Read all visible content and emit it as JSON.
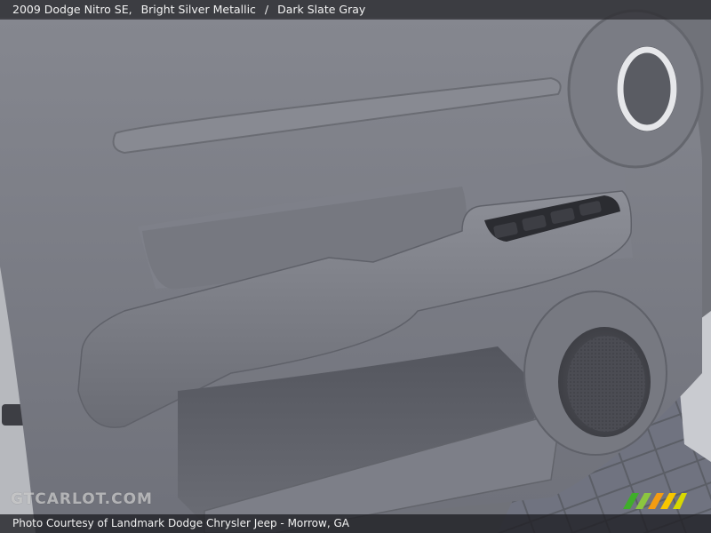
{
  "header": {
    "vehicle": "2009 Dodge Nitro SE,",
    "exterior_color": "Bright Silver Metallic",
    "separator": "/",
    "interior_color": "Dark Slate Gray"
  },
  "footer": {
    "credit": "Photo Courtesy of Landmark Dodge Chrysler Jeep - Morrow, GA"
  },
  "watermark": {
    "text": "GTCARLOT.COM"
  },
  "photo": {
    "subject": "door-panel-interior",
    "colors": {
      "panel": "#7c7e86",
      "panel_light": "#8b8d95",
      "panel_dark": "#5e6068",
      "switch": "#2b2c31",
      "speaker": "#4a4b52"
    }
  },
  "icons": {
    "logo": "gtcarlot-stripes-logo"
  }
}
